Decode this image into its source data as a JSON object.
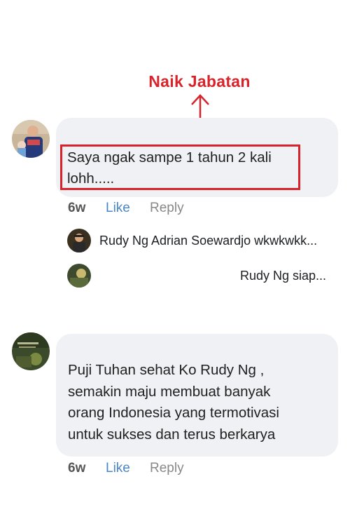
{
  "annotation": {
    "title": "Naik Jabatan"
  },
  "comments": [
    {
      "text_lines": [
        "Saya ngak sampe 1 tahun 2 kali",
        "lohh....."
      ],
      "time": "6w",
      "like_label": "Like",
      "reply_label": "Reply"
    },
    {
      "text_lines": [
        "Puji Tuhan sehat Ko Rudy Ng ,",
        "semakin maju membuat banyak",
        "orang Indonesia yang termotivasi",
        "untuk sukses dan terus berkarya"
      ],
      "time": "6w",
      "like_label": "Like",
      "reply_label": "Reply"
    }
  ],
  "replies": [
    {
      "text": "Rudy Ng Adrian Soewardjo wkwkwkk..."
    },
    {
      "text": "Rudy Ng  siap..."
    }
  ],
  "colors": {
    "highlight": "#d9232b",
    "like": "#4a86c6",
    "bubble": "#eff1f4"
  }
}
